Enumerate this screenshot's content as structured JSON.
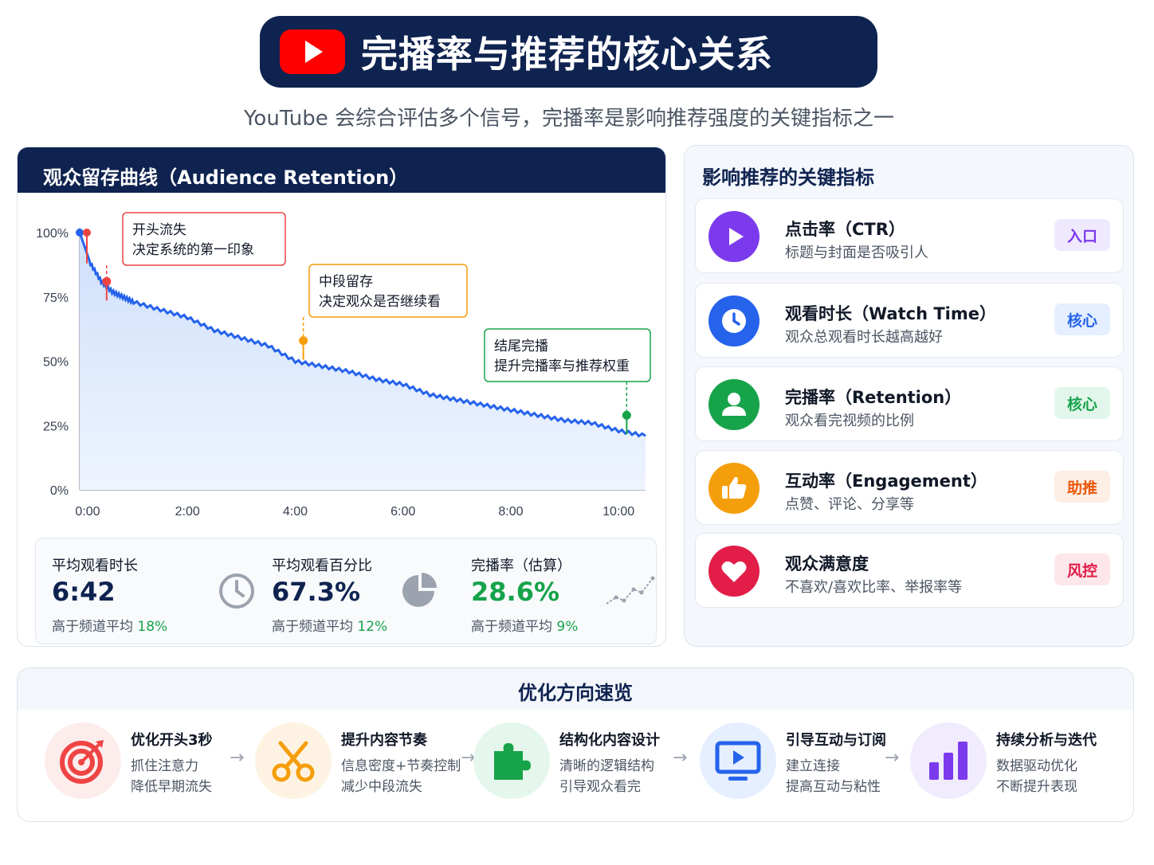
{
  "header": {
    "title": "完播率与推荐的核心关系",
    "subtitle": "YouTube 会综合评估多个信号，完播率是影响推荐强度的关键指标之一"
  },
  "retention_panel": {
    "title": "观众留存曲线（Audience Retention）",
    "callouts": [
      {
        "line1": "开头流失",
        "line2": "决定系统的第一印象"
      },
      {
        "line1": "中段留存",
        "line2": "决定观众是否继续看"
      },
      {
        "line1": "结尾完播",
        "line2": "提升完播率与推荐权重"
      }
    ],
    "stats": [
      {
        "label": "平均观看时长",
        "value": "6:42",
        "note_prefix": "高于频道平均 ",
        "note_value": "18%"
      },
      {
        "label": "平均观看百分比",
        "value": "67.3%",
        "note_prefix": "高于频道平均 ",
        "note_value": "12%"
      },
      {
        "label": "完播率（估算）",
        "value": "28.6%",
        "note_prefix": "高于频道平均 ",
        "note_value": "9%"
      }
    ]
  },
  "chart_data": {
    "type": "area",
    "x_ticks": [
      "0:00",
      "2:00",
      "4:00",
      "6:00",
      "8:00",
      "10:00"
    ],
    "y_ticks": [
      "0%",
      "25%",
      "50%",
      "75%",
      "100%"
    ],
    "xlim_minutes": [
      0,
      10.5
    ],
    "ylim": [
      0,
      100
    ],
    "x_minutes": [
      0,
      0.2,
      0.4,
      0.6,
      0.8,
      1.0,
      1.5,
      2.0,
      2.5,
      3.0,
      3.5,
      4.0,
      4.5,
      5.0,
      5.5,
      6.0,
      6.5,
      7.0,
      7.5,
      8.0,
      8.5,
      9.0,
      9.5,
      10.0,
      10.5
    ],
    "y_percent": [
      100,
      88,
      81,
      77,
      75,
      73,
      70,
      67,
      62,
      59,
      56,
      50,
      48,
      46,
      43,
      41,
      37,
      35,
      33,
      31,
      29,
      27,
      26,
      23,
      21
    ],
    "markers": [
      {
        "x": 0.5,
        "y": 81,
        "color": "#ef4444"
      },
      {
        "x": 4.15,
        "y": 58,
        "color": "#f59e0b"
      },
      {
        "x": 10.15,
        "y": 29,
        "color": "#16a34a"
      }
    ]
  },
  "metrics_panel": {
    "title": "影响推荐的关键指标",
    "items": [
      {
        "title": "点击率（CTR）",
        "desc": "标题与封面是否吸引人",
        "badge": "入口",
        "icon": "play-icon",
        "color": "#7c3aed",
        "badge_bg": "#efe9fd",
        "badge_fg": "#7c3aed"
      },
      {
        "title": "观看时长（Watch Time）",
        "desc": "观众总观看时长越高越好",
        "badge": "核心",
        "icon": "clock-icon",
        "color": "#2563eb",
        "badge_bg": "#e5efff",
        "badge_fg": "#2563eb"
      },
      {
        "title": "完播率（Retention）",
        "desc": "观众看完视频的比例",
        "badge": "核心",
        "icon": "user-icon",
        "color": "#16a34a",
        "badge_bg": "#e3f6ec",
        "badge_fg": "#16a34a"
      },
      {
        "title": "互动率（Engagement）",
        "desc": "点赞、评论、分享等",
        "badge": "助推",
        "icon": "thumbs-up-icon",
        "color": "#f59e0b",
        "badge_bg": "#fdeee6",
        "badge_fg": "#ea580c"
      },
      {
        "title": "观众满意度",
        "desc": "不喜欢/喜欢比率、举报率等",
        "badge": "风控",
        "icon": "heart-icon",
        "color": "#e11d48",
        "badge_bg": "#fde7ea",
        "badge_fg": "#e11d48"
      }
    ]
  },
  "optimization": {
    "title": "优化方向速览",
    "steps": [
      {
        "title": "优化开头3秒",
        "line1": "抓住注意力",
        "line2": "降低早期流失",
        "icon": "target-icon"
      },
      {
        "title": "提升内容节奏",
        "line1": "信息密度+节奏控制",
        "line2": "减少中段流失",
        "icon": "scissors-icon"
      },
      {
        "title": "结构化内容设计",
        "line1": "清晰的逻辑结构",
        "line2": "引导观众看完",
        "icon": "puzzle-icon"
      },
      {
        "title": "引导互动与订阅",
        "line1": "建立连接",
        "line2": "提高互动与粘性",
        "icon": "monitor-play-icon"
      },
      {
        "title": "持续分析与迭代",
        "line1": "数据驱动优化",
        "line2": "不断提升表现",
        "icon": "bar-chart-icon"
      }
    ]
  }
}
